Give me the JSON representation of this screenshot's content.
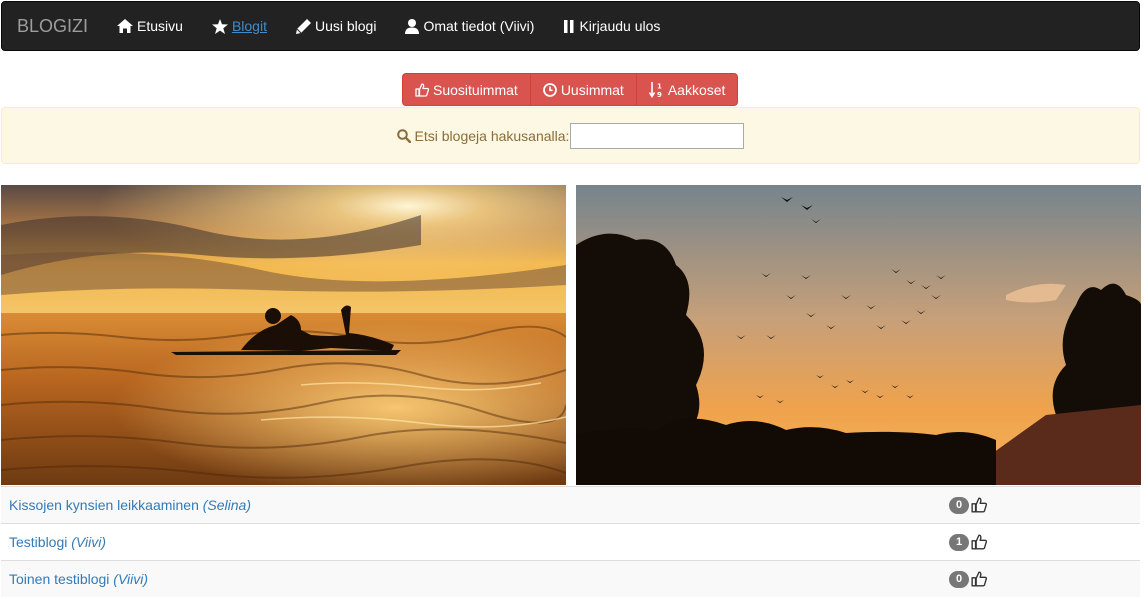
{
  "navbar": {
    "brand": "BLOGIZI",
    "items": [
      {
        "label": "Etusivu",
        "icon": "home-icon"
      },
      {
        "label": "Blogit",
        "icon": "star-icon",
        "active": true
      },
      {
        "label": "Uusi blogi",
        "icon": "pencil-icon"
      },
      {
        "label": "Omat tiedot (Viivi)",
        "icon": "user-icon"
      },
      {
        "label": "Kirjaudu ulos",
        "icon": "pause-icon"
      }
    ]
  },
  "sort_buttons": [
    {
      "label": "Suosituimmat",
      "icon": "thumbs-up-icon"
    },
    {
      "label": "Uusimmat",
      "icon": "clock-icon"
    },
    {
      "label": "Aakkoset",
      "icon": "sort-alphabet-icon"
    }
  ],
  "search": {
    "label": "Etsi blogeja hakusanalla:",
    "value": ""
  },
  "blogs": [
    {
      "title": "Kissojen kynsien leikkaaminen",
      "author": "(Selina)",
      "likes": "0"
    },
    {
      "title": "Testiblogi",
      "author": "(Viivi)",
      "likes": "1"
    },
    {
      "title": "Toinen testiblogi",
      "author": "(Viivi)",
      "likes": "0"
    }
  ],
  "colors": {
    "navbar_bg": "#222222",
    "button_danger": "#d9534f",
    "well_bg": "#fcf8e3",
    "link": "#337ab7",
    "badge": "#777777"
  }
}
